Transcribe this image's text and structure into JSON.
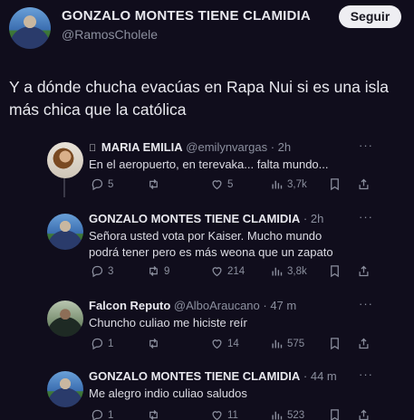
{
  "header": {
    "name": "GONZALO MONTES TIENE CLAMIDIA",
    "handle": "@RamosCholele",
    "follow_label": "Seguir"
  },
  "tweet": {
    "text": "Y a dónde chucha evacúas en Rapa Nui si es una isla más chica que la católica"
  },
  "replies": [
    {
      "name": "MARIA EMILIA",
      "prefix_icon": "apple-icon",
      "handle_time": "@emilynvargas · 2h",
      "text": "En el aeropuerto, en terevaka... falta mundo...",
      "reply_count": "5",
      "retweet_count": "",
      "like_count": "5",
      "view_count": "3,7k"
    },
    {
      "name": "GONZALO MONTES TIENE CLAMIDIA",
      "handle_time": " · 2h",
      "text": "Señora usted vota por Kaiser. Mucho mundo podrá tener pero es más weona que un zapato",
      "reply_count": "3",
      "retweet_count": "9",
      "like_count": "214",
      "view_count": "3,8k"
    },
    {
      "name": "Falcon Reputo",
      "handle_time": "@AlboAraucano · 47 m",
      "text": "Chuncho culiao me hiciste reír",
      "reply_count": "1",
      "retweet_count": "",
      "like_count": "14",
      "view_count": "575"
    },
    {
      "name": "GONZALO MONTES TIENE CLAMIDIA",
      "handle_time": " · 44 m",
      "text": "Me alegro indio culiao saludos",
      "reply_count": "1",
      "retweet_count": "",
      "like_count": "11",
      "view_count": "523"
    }
  ],
  "more_label": "···",
  "colors": {
    "background": "#100d1c",
    "text": "#e7e9ea",
    "secondary_text": "#8b8f9e",
    "follow_button": "#eeeef2"
  }
}
